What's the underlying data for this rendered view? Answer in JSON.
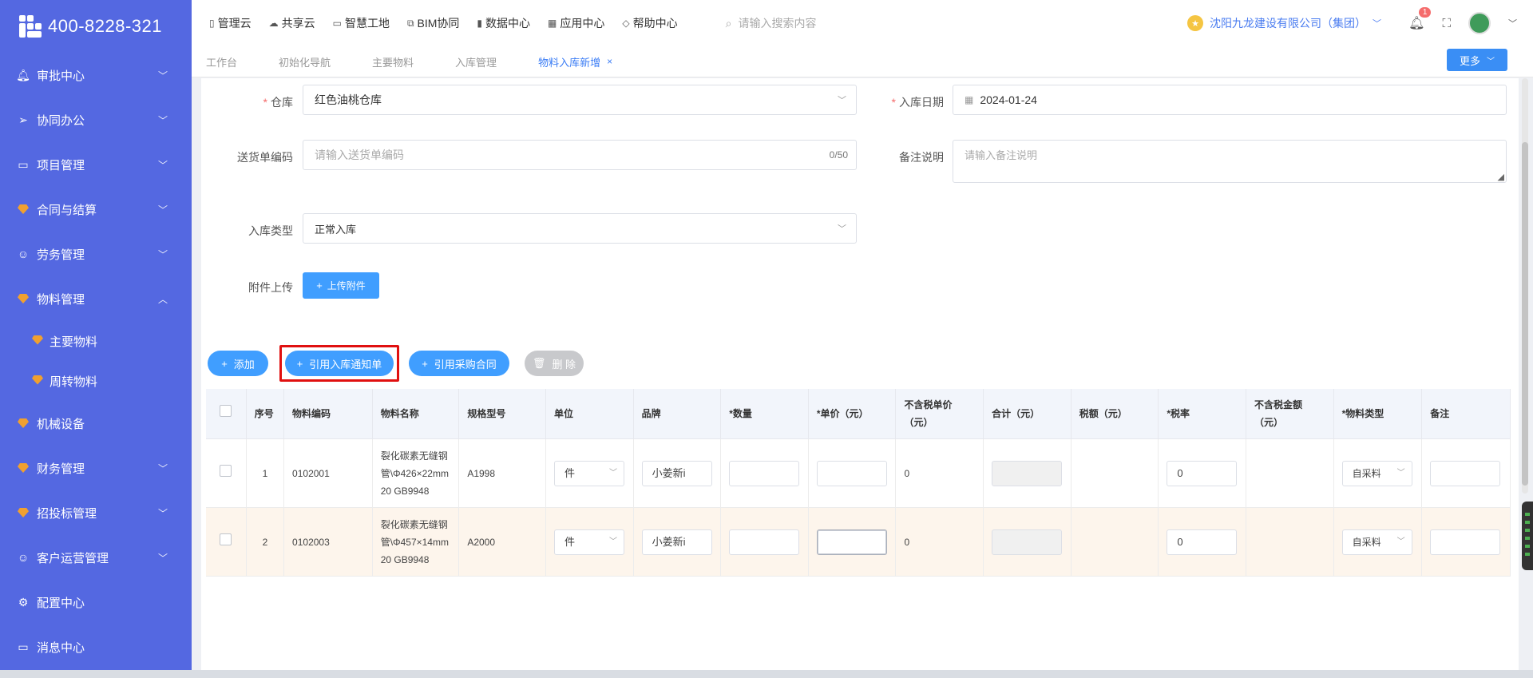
{
  "brand": {
    "phone": "400-8228-321"
  },
  "sidebar": {
    "items": [
      {
        "label": "审批中心",
        "icon": "bell-icon",
        "chevron": "down"
      },
      {
        "label": "协同办公",
        "icon": "send-icon",
        "chevron": "down"
      },
      {
        "label": "项目管理",
        "icon": "book-icon",
        "chevron": "down"
      },
      {
        "label": "合同与结算",
        "icon": "gem-icon",
        "chevron": "down"
      },
      {
        "label": "劳务管理",
        "icon": "worker-icon",
        "chevron": "down"
      },
      {
        "label": "物料管理",
        "icon": "gem-icon",
        "chevron": "up"
      },
      {
        "label": "机械设备",
        "icon": "gem-icon",
        "chevron": ""
      },
      {
        "label": "财务管理",
        "icon": "gem-icon",
        "chevron": "down"
      },
      {
        "label": "招投标管理",
        "icon": "gem-icon",
        "chevron": "down"
      },
      {
        "label": "客户运营管理",
        "icon": "worker-icon",
        "chevron": "down"
      },
      {
        "label": "配置中心",
        "icon": "gear-icon",
        "chevron": ""
      },
      {
        "label": "消息中心",
        "icon": "message-icon",
        "chevron": ""
      }
    ],
    "material_sub": [
      "主要物料",
      "周转物料"
    ]
  },
  "topnav": {
    "items": [
      "管理云",
      "共享云",
      "智慧工地",
      "BIM协同",
      "数据中心",
      "应用中心",
      "帮助中心"
    ],
    "search_placeholder": "请输入搜索内容",
    "company": "沈阳九龙建设有限公司（集团）",
    "notification_count": "1"
  },
  "tabs": {
    "items": [
      "工作台",
      "初始化导航",
      "主要物料",
      "入库管理",
      "物料入库新增"
    ],
    "active": "物料入库新增",
    "more_label": "更多"
  },
  "form": {
    "warehouse_label": "仓库",
    "warehouse_value": "红色油桃仓库",
    "date_label": "入库日期",
    "date_value": "2024-01-24",
    "delivery_label": "送货单编码",
    "delivery_placeholder": "请输入送货单编码",
    "delivery_count": "0/50",
    "remark_label": "备注说明",
    "remark_placeholder": "请输入备注说明",
    "type_label": "入库类型",
    "type_value": "正常入库",
    "attach_label": "附件上传",
    "attach_button": "上传附件"
  },
  "actions": {
    "add": "添加",
    "ref_notice": "引用入库通知单",
    "ref_contract": "引用采购合同",
    "delete": "删 除"
  },
  "table": {
    "headers": [
      "序号",
      "物料编码",
      "物料名称",
      "规格型号",
      "单位",
      "品牌",
      "*数量",
      "*单价（元）",
      "不含税单价（元）",
      "合计（元）",
      "税额（元）",
      "*税率",
      "不含税金额（元）",
      "*物料类型",
      "备注"
    ],
    "rows": [
      {
        "no": "1",
        "code": "0102001",
        "name": "裂化碳素无缝钢管\\Φ426×22mm 20 GB9948",
        "spec": "A1998",
        "unit": "件",
        "brand": "小姜新i",
        "ex_tax_price": "0",
        "tax_rate": "0",
        "mat_type": "自采料"
      },
      {
        "no": "2",
        "code": "0102003",
        "name": "裂化碳素无缝钢管\\Φ457×14mm 20 GB9948",
        "spec": "A2000",
        "unit": "件",
        "brand": "小姜新i",
        "ex_tax_price": "0",
        "tax_rate": "0",
        "mat_type": "自采料"
      }
    ]
  }
}
